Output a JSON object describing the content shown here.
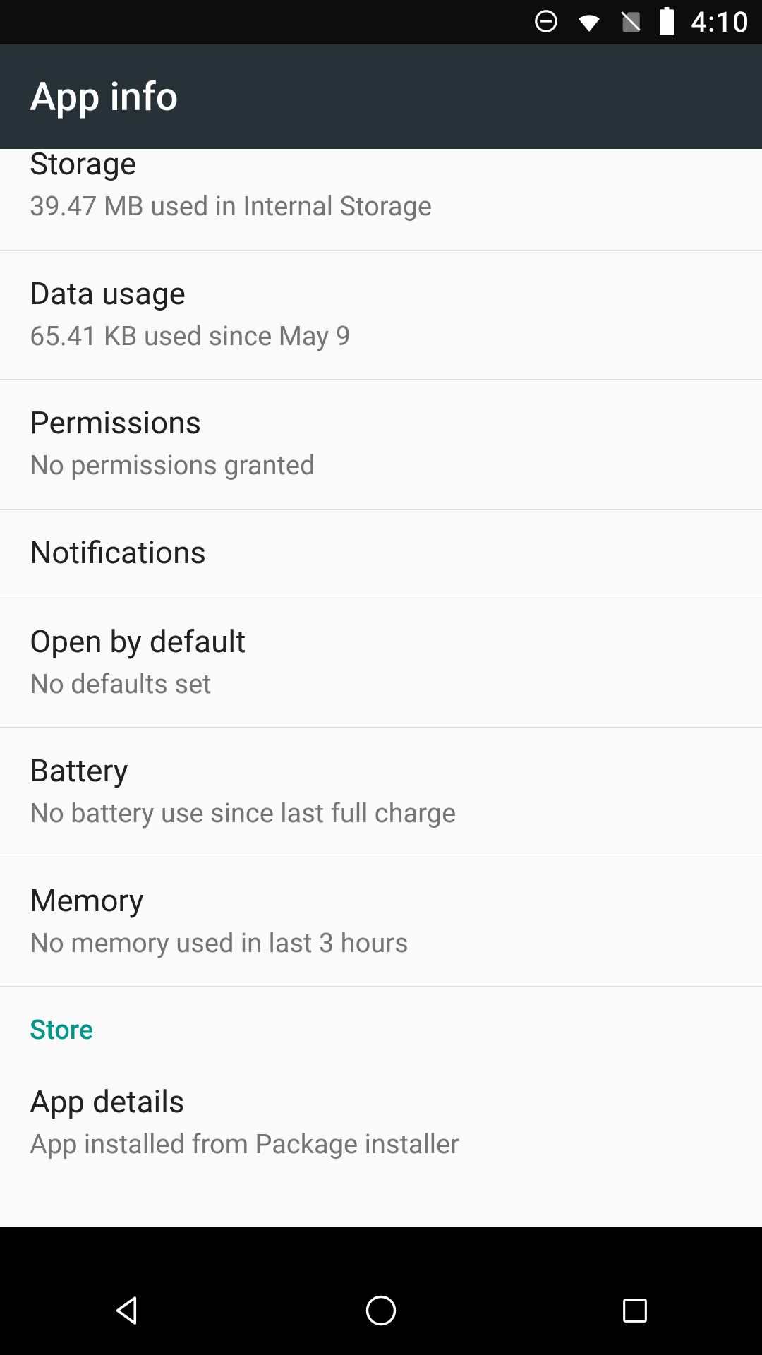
{
  "status_bar": {
    "time": "4:10"
  },
  "app_bar": {
    "title": "App info"
  },
  "list": {
    "storage": {
      "title": "Storage",
      "sub": "39.47 MB used in Internal Storage"
    },
    "data_usage": {
      "title": "Data usage",
      "sub": "65.41 KB used since May 9"
    },
    "permissions": {
      "title": "Permissions",
      "sub": "No permissions granted"
    },
    "notifications": {
      "title": "Notifications"
    },
    "open_default": {
      "title": "Open by default",
      "sub": "No defaults set"
    },
    "battery": {
      "title": "Battery",
      "sub": "No battery use since last full charge"
    },
    "memory": {
      "title": "Memory",
      "sub": "No memory used in last 3 hours"
    },
    "section_store": {
      "label": "Store"
    },
    "app_details": {
      "title": "App details",
      "sub": "App installed from Package installer"
    }
  }
}
